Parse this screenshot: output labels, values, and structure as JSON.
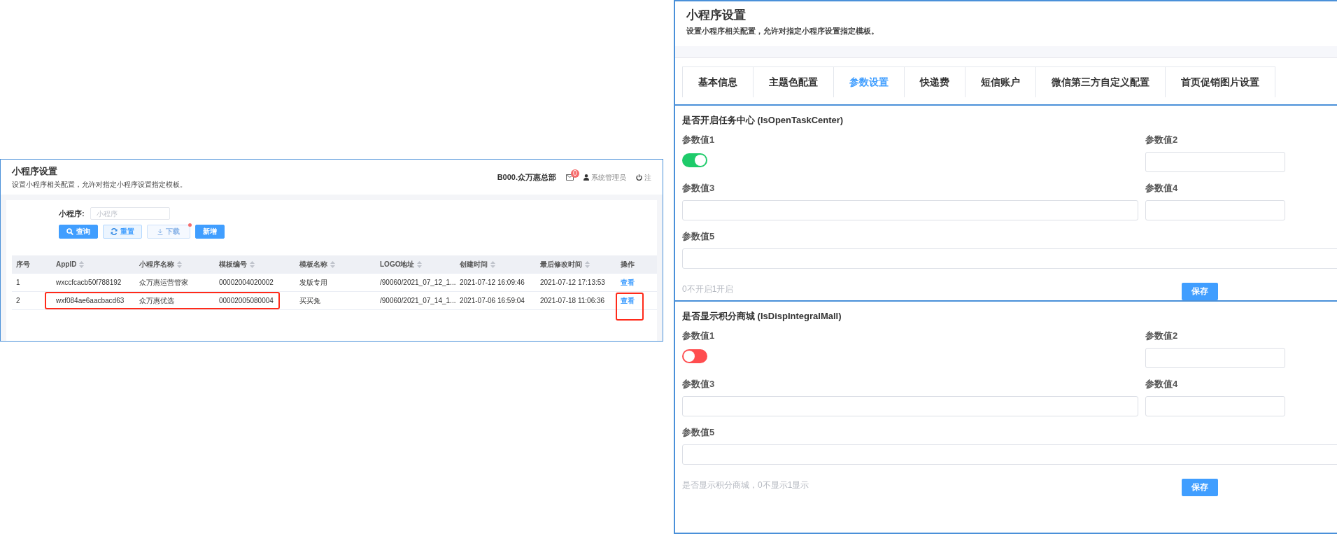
{
  "left_panel": {
    "title": "小程序设置",
    "subtitle": "设置小程序相关配置，允许对指定小程序设置指定模板。",
    "org": "B000.众万惠总部",
    "mail_badge": "0",
    "user": "系统管理员",
    "logout": "注",
    "filter": {
      "label": "小程序:",
      "placeholder": "小程序"
    },
    "buttons": [
      {
        "label": "查询",
        "kind": "search",
        "dot": false
      },
      {
        "label": "重置",
        "kind": "reset",
        "dot": false
      },
      {
        "label": "下载",
        "kind": "download",
        "dot": true
      },
      {
        "label": "新增",
        "kind": "add",
        "dot": false
      }
    ],
    "table": {
      "columns": [
        {
          "label": "序号",
          "sortable": false
        },
        {
          "label": "AppID",
          "sortable": true
        },
        {
          "label": "小程序名称",
          "sortable": true
        },
        {
          "label": "模板编号",
          "sortable": true
        },
        {
          "label": "模板名称",
          "sortable": true
        },
        {
          "label": "LOGO地址",
          "sortable": true
        },
        {
          "label": "创建时间",
          "sortable": true
        },
        {
          "label": "最后修改时间",
          "sortable": true
        },
        {
          "label": "操作",
          "sortable": false
        }
      ],
      "rows": [
        {
          "cells": [
            "1",
            "wxccfcacb50f788192",
            "众万惠运营管家",
            "00002004020002",
            "发版专用",
            "/90060/2021_07_12_1...",
            "2021-07-12 16:09:46",
            "2021-07-12 17:13:53"
          ],
          "action": "查看",
          "annotated": false
        },
        {
          "cells": [
            "2",
            "wxf084ae6aacbacd63",
            "众万惠优选",
            "00002005080004",
            "买买兔",
            "/90060/2021_07_14_1...",
            "2021-07-06 16:59:04",
            "2021-07-18 11:06:36"
          ],
          "action": "查看",
          "annotated": true
        }
      ]
    }
  },
  "right_panel": {
    "title": "小程序设置",
    "subtitle": "设置小程序相关配置，允许对指定小程序设置指定模板。",
    "tabs": [
      {
        "label": "基本信息",
        "selected": false
      },
      {
        "label": "主题色配置",
        "selected": false
      },
      {
        "label": "参数设置",
        "selected": true
      },
      {
        "label": "快递费",
        "selected": false
      },
      {
        "label": "短信账户",
        "selected": false
      },
      {
        "label": "微信第三方自定义配置",
        "selected": false
      },
      {
        "label": "首页促销图片设置",
        "selected": false
      }
    ],
    "sections": [
      {
        "title": "是否开启任务中心 (IsOpenTaskCenter)",
        "toggle_label": "参数值1",
        "on": true,
        "fields": [
          "参数值2",
          "参数值3",
          "参数值4",
          "参数值5"
        ],
        "hint": "0不开启1开启",
        "save": "保存"
      },
      {
        "title": "是否显示积分商城 (IsDispIntegralMall)",
        "toggle_label": "参数值1",
        "on": false,
        "fields": [
          "参数值2",
          "参数值3",
          "参数值4",
          "参数值5"
        ],
        "hint": "是否显示积分商城，0不显示1显示",
        "save": "保存"
      }
    ]
  }
}
